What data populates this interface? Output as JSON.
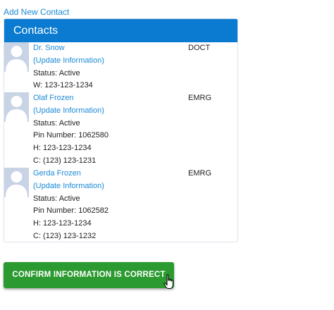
{
  "add_contact_label": "Add New Contact",
  "panel": {
    "title": "Contacts"
  },
  "contacts": [
    {
      "name": "Dr. Snow",
      "update_label": "(Update Information)",
      "code": "DOCT",
      "lines": [
        "Status: Active",
        "W: 123-123-1234"
      ]
    },
    {
      "name": "Olaf Frozen",
      "update_label": "(Update Information)",
      "code": "EMRG",
      "lines": [
        "Status: Active",
        "Pin Number: 1062580",
        "H: 123-123-1234",
        "C: (123) 123-1231"
      ]
    },
    {
      "name": "Gerda Frozen",
      "update_label": "(Update Information)",
      "code": "EMRG",
      "lines": [
        "Status: Active",
        "Pin Number: 1062582",
        "H: 123-123-1234",
        "C: (123) 123-1232"
      ]
    }
  ],
  "confirm_label": "CONFIRM INFORMATION IS CORRECT",
  "colors": {
    "accent": "#0a7bd0",
    "link": "#1a8ad6",
    "confirm": "#2b9a30",
    "avatar_bg": "#c9d3e6"
  },
  "icons": {
    "avatar": "person-silhouette-icon",
    "cursor": "hand-pointer-icon"
  }
}
